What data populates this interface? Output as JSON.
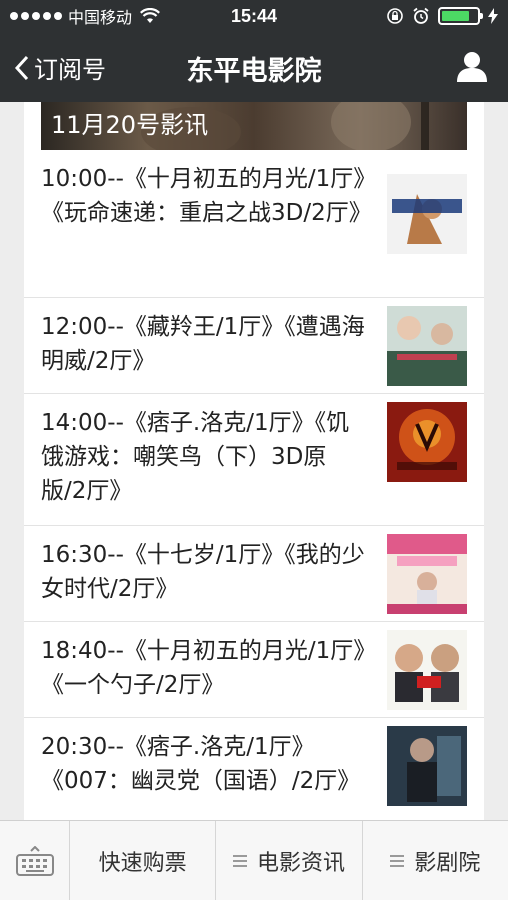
{
  "status_bar": {
    "carrier": "中国移动",
    "time": "15:44",
    "battery_level": 0.8
  },
  "nav": {
    "back_label": "订阅号",
    "title": "东平电影院"
  },
  "banner": {
    "text": "11月20号影讯"
  },
  "showtimes": [
    {
      "text": "10:00--《十月初五的月光/1厅》《玩命速递：重启之战3D/2厅》",
      "poster_caption": "玩命速递"
    },
    {
      "text": "12:00--《藏羚王/1厅》《遭遇海明威/2厅》",
      "poster_caption": "遭遇海明威"
    },
    {
      "text": "14:00--《痞子.洛克/1厅》《饥饿游戏：嘲笑鸟（下）3D原版/2厅》",
      "poster_caption": "饥饿游戏3"
    },
    {
      "text": "16:30--《十七岁/1厅》《我的少女时代/2厅》",
      "poster_caption": "我的少女时代"
    },
    {
      "text": "18:40--《十月初五的月光/1厅》《一个勺子/2厅》",
      "poster_caption": "一个勺子"
    },
    {
      "text": "20:30--《痞子.洛克/1厅》《007：幽灵党（国语）/2厅》",
      "poster_caption": "007"
    }
  ],
  "bottom_menu": {
    "item1": "快速购票",
    "item2": "电影资讯",
    "item3": "影剧院"
  },
  "icons": {
    "wifi": "wifi-icon",
    "back": "chevron-left-icon",
    "user": "user-icon",
    "keyboard": "keyboard-icon",
    "menu": "menu-icon"
  },
  "colors": {
    "nav_bg": "#2e3133",
    "battery": "#4cd964"
  }
}
